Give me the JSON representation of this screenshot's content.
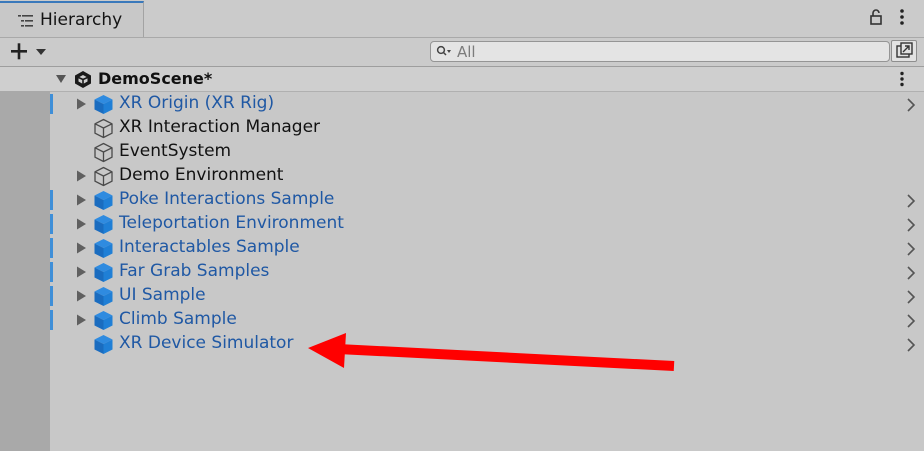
{
  "tab": {
    "title": "Hierarchy"
  },
  "search": {
    "placeholder": "All"
  },
  "scene": {
    "name": "DemoScene*"
  },
  "items": [
    {
      "label": "XR Origin (XR Rig)",
      "prefab": true,
      "expandable": true,
      "override_bar": true,
      "chevron": true
    },
    {
      "label": "XR Interaction Manager",
      "prefab": false,
      "expandable": false,
      "override_bar": false,
      "chevron": false
    },
    {
      "label": "EventSystem",
      "prefab": false,
      "expandable": false,
      "override_bar": false,
      "chevron": false
    },
    {
      "label": "Demo Environment",
      "prefab": false,
      "expandable": true,
      "override_bar": false,
      "chevron": false
    },
    {
      "label": "Poke Interactions Sample",
      "prefab": true,
      "expandable": true,
      "override_bar": true,
      "chevron": true
    },
    {
      "label": "Teleportation Environment",
      "prefab": true,
      "expandable": true,
      "override_bar": true,
      "chevron": true
    },
    {
      "label": "Interactables Sample",
      "prefab": true,
      "expandable": true,
      "override_bar": true,
      "chevron": true
    },
    {
      "label": "Far Grab Samples",
      "prefab": true,
      "expandable": true,
      "override_bar": true,
      "chevron": true
    },
    {
      "label": "UI Sample",
      "prefab": true,
      "expandable": true,
      "override_bar": true,
      "chevron": true
    },
    {
      "label": "Climb Sample",
      "prefab": true,
      "expandable": true,
      "override_bar": true,
      "chevron": true
    },
    {
      "label": "XR Device Simulator",
      "prefab": true,
      "expandable": false,
      "override_bar": false,
      "chevron": true
    }
  ],
  "colors": {
    "prefab_text": "#1f58a4",
    "prefab_cube": "#1f7fd6",
    "override_bar": "#3f8fd8",
    "annotation_arrow": "#ff0000"
  },
  "icons": {
    "tab": "hierarchy-list-icon",
    "lock": "lock-icon",
    "menu": "kebab-menu-icon",
    "add": "plus-dropdown-icon",
    "search": "search-icon",
    "scene_visibility": "scene-view-icon",
    "scene": "unity-scene-icon",
    "prefab": "prefab-cube-icon",
    "gameobject": "gameobject-cube-icon"
  }
}
